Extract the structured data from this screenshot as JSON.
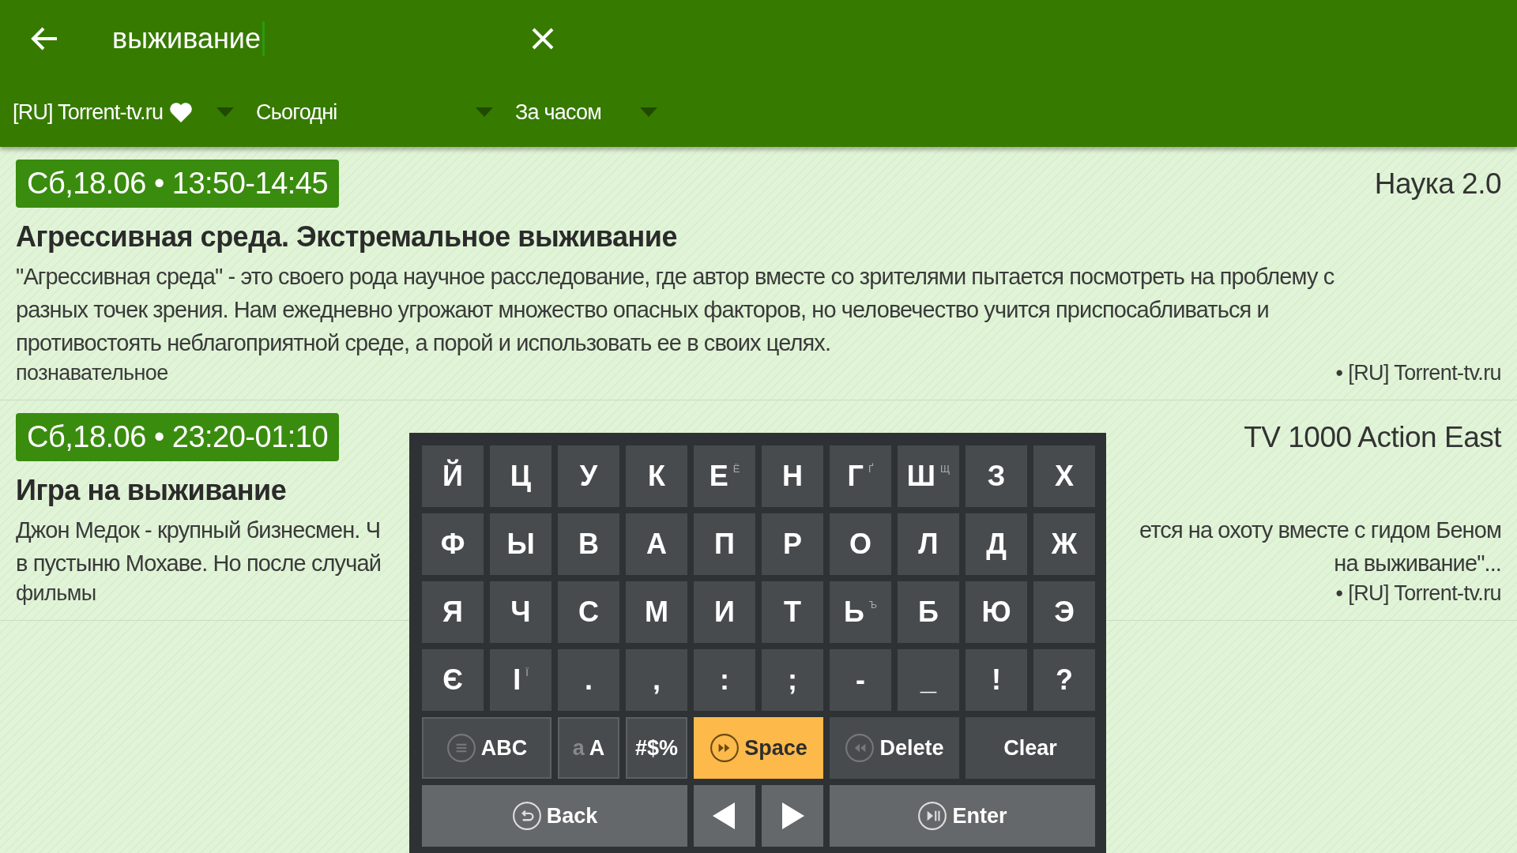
{
  "search": {
    "value": "выживание"
  },
  "filters": [
    {
      "label": "[RU] Torrent-tv.ru",
      "favorite": true
    },
    {
      "label": "Сьогодні",
      "favorite": false
    },
    {
      "label": "За часом",
      "favorite": false
    }
  ],
  "programs": [
    {
      "time": "Сб,18.06 • 13:50-14:45",
      "channel": "Наука 2.0",
      "title": "Агрессивная среда. Экстремальное выживание",
      "description_lines": [
        {
          "left": "\"Агрессивная среда\" - это своего рода научное расследование, где автор вместе со зрителями пытается посмотреть на проблему с"
        },
        {
          "left": "разных точек зрения. Нам ежедневно угрожают множество опасных факторов, но человечество учится приспосабливаться и"
        },
        {
          "left": "противостоять неблагоприятной среде, а порой и использовать ее в своих целях."
        }
      ],
      "genre": "познавательное",
      "source": "• [RU] Torrent-tv.ru"
    },
    {
      "time": "Сб,18.06 • 23:20-01:10",
      "channel": "TV 1000 Action East",
      "title": "Игра на выживание",
      "description_lines": [
        {
          "left": "Джон Медок - крупный бизнесмен. Ч",
          "right": "ется на охоту вместе с гидом Беном"
        },
        {
          "left": "в пустыню Мохаве. Но после случай",
          "right": "на выживание\"..."
        }
      ],
      "genre": "фильмы",
      "source": "• [RU] Torrent-tv.ru"
    }
  ],
  "keyboard": {
    "rows": [
      [
        {
          "kind": "char",
          "label": "Й"
        },
        {
          "kind": "char",
          "label": "Ц"
        },
        {
          "kind": "char",
          "label": "У"
        },
        {
          "kind": "char",
          "label": "К"
        },
        {
          "kind": "char",
          "label": "Е",
          "alt": "Ё"
        },
        {
          "kind": "char",
          "label": "Н"
        },
        {
          "kind": "char",
          "label": "Г",
          "alt": "Ґ"
        },
        {
          "kind": "char",
          "label": "Ш",
          "alt": "Щ"
        },
        {
          "kind": "char",
          "label": "З"
        },
        {
          "kind": "char",
          "label": "Х"
        }
      ],
      [
        {
          "kind": "char",
          "label": "Ф"
        },
        {
          "kind": "char",
          "label": "Ы"
        },
        {
          "kind": "char",
          "label": "В"
        },
        {
          "kind": "char",
          "label": "А"
        },
        {
          "kind": "char",
          "label": "П"
        },
        {
          "kind": "char",
          "label": "Р"
        },
        {
          "kind": "char",
          "label": "О"
        },
        {
          "kind": "char",
          "label": "Л"
        },
        {
          "kind": "char",
          "label": "Д"
        },
        {
          "kind": "char",
          "label": "Ж"
        }
      ],
      [
        {
          "kind": "char",
          "label": "Я"
        },
        {
          "kind": "char",
          "label": "Ч"
        },
        {
          "kind": "char",
          "label": "С"
        },
        {
          "kind": "char",
          "label": "М"
        },
        {
          "kind": "char",
          "label": "И"
        },
        {
          "kind": "char",
          "label": "Т"
        },
        {
          "kind": "char",
          "label": "Ь",
          "alt": "Ъ"
        },
        {
          "kind": "char",
          "label": "Б"
        },
        {
          "kind": "char",
          "label": "Ю"
        },
        {
          "kind": "char",
          "label": "Э"
        }
      ],
      [
        {
          "kind": "char",
          "label": "Є"
        },
        {
          "kind": "char",
          "label": "І",
          "alt": "Ї"
        },
        {
          "kind": "char",
          "label": "."
        },
        {
          "kind": "char",
          "label": ","
        },
        {
          "kind": "char",
          "label": ":"
        },
        {
          "kind": "char",
          "label": ";"
        },
        {
          "kind": "char",
          "label": "-"
        },
        {
          "kind": "char",
          "label": "_"
        },
        {
          "kind": "char",
          "label": "!"
        },
        {
          "kind": "char",
          "label": "?"
        }
      ]
    ],
    "function_keys": [
      {
        "kind": "abc",
        "label": "ABC",
        "selected": false
      },
      {
        "kind": "case",
        "dim": "a",
        "label": "A",
        "selected": false
      },
      {
        "kind": "symbols",
        "label": "#$%",
        "selected": false
      },
      {
        "kind": "space",
        "label": "Space",
        "selected": true
      },
      {
        "kind": "delete",
        "label": "Delete",
        "selected": false
      },
      {
        "kind": "clear",
        "label": "Clear",
        "selected": false
      }
    ],
    "nav_keys": [
      {
        "kind": "back",
        "label": "Back",
        "selected": false
      },
      {
        "kind": "left",
        "selected": false
      },
      {
        "kind": "right",
        "selected": false
      },
      {
        "kind": "enter",
        "label": "Enter",
        "selected": false
      }
    ]
  }
}
